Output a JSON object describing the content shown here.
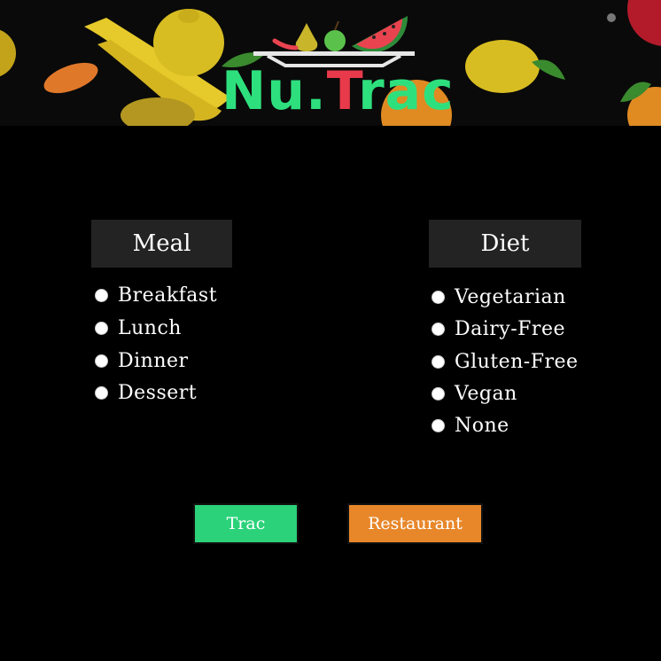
{
  "header": {
    "logo_part1": "Nu",
    "logo_dot": ".",
    "logo_t": "T",
    "logo_part2": "rac"
  },
  "meal": {
    "title": "Meal",
    "options": [
      "Breakfast",
      "Lunch",
      "Dinner",
      "Dessert"
    ]
  },
  "diet": {
    "title": "Diet",
    "options": [
      "Vegetarian",
      "Dairy-Free",
      "Gluten-Free",
      "Vegan",
      "None"
    ]
  },
  "buttons": {
    "trac": "Trac",
    "restaurant": "Restaurant"
  },
  "colors": {
    "background": "#000000",
    "logo_green": "#2ee07d",
    "logo_red": "#e83a4a",
    "trac_button": "#2bd27a",
    "restaurant_button": "#e8872a",
    "group_header": "#232323"
  }
}
